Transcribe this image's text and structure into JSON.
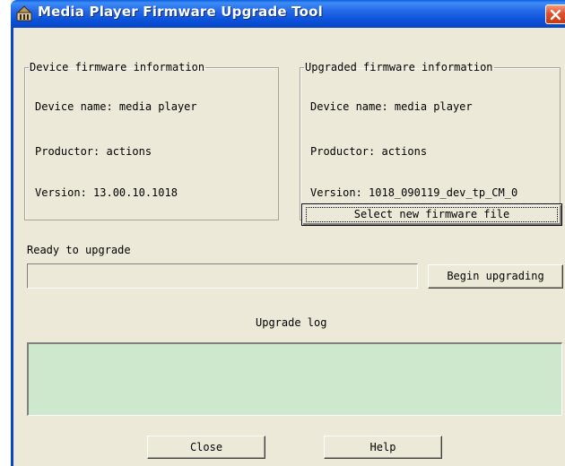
{
  "window": {
    "title": "Media Player Firmware Upgrade Tool",
    "icons": {
      "app": "app-icon",
      "close": "close-icon"
    }
  },
  "device_info": {
    "legend": "Device firmware information",
    "name": "Device name: media player",
    "productor": "Productor: actions",
    "version": "Version: 13.00.10.1018"
  },
  "upgraded_info": {
    "legend": "Upgraded firmware information",
    "name": "Device name: media player",
    "productor": "Productor: actions",
    "version": "Version: 1018_090119_dev_tp_CM_0"
  },
  "select_file_button": "Select new firmware file",
  "status": {
    "label": "Ready to upgrade",
    "progress": 0
  },
  "begin_button": "Begin upgrading",
  "log": {
    "label": "Upgrade log",
    "background": "#cde8cc"
  },
  "footer": {
    "close_button": "Close",
    "help_button": "Help"
  }
}
